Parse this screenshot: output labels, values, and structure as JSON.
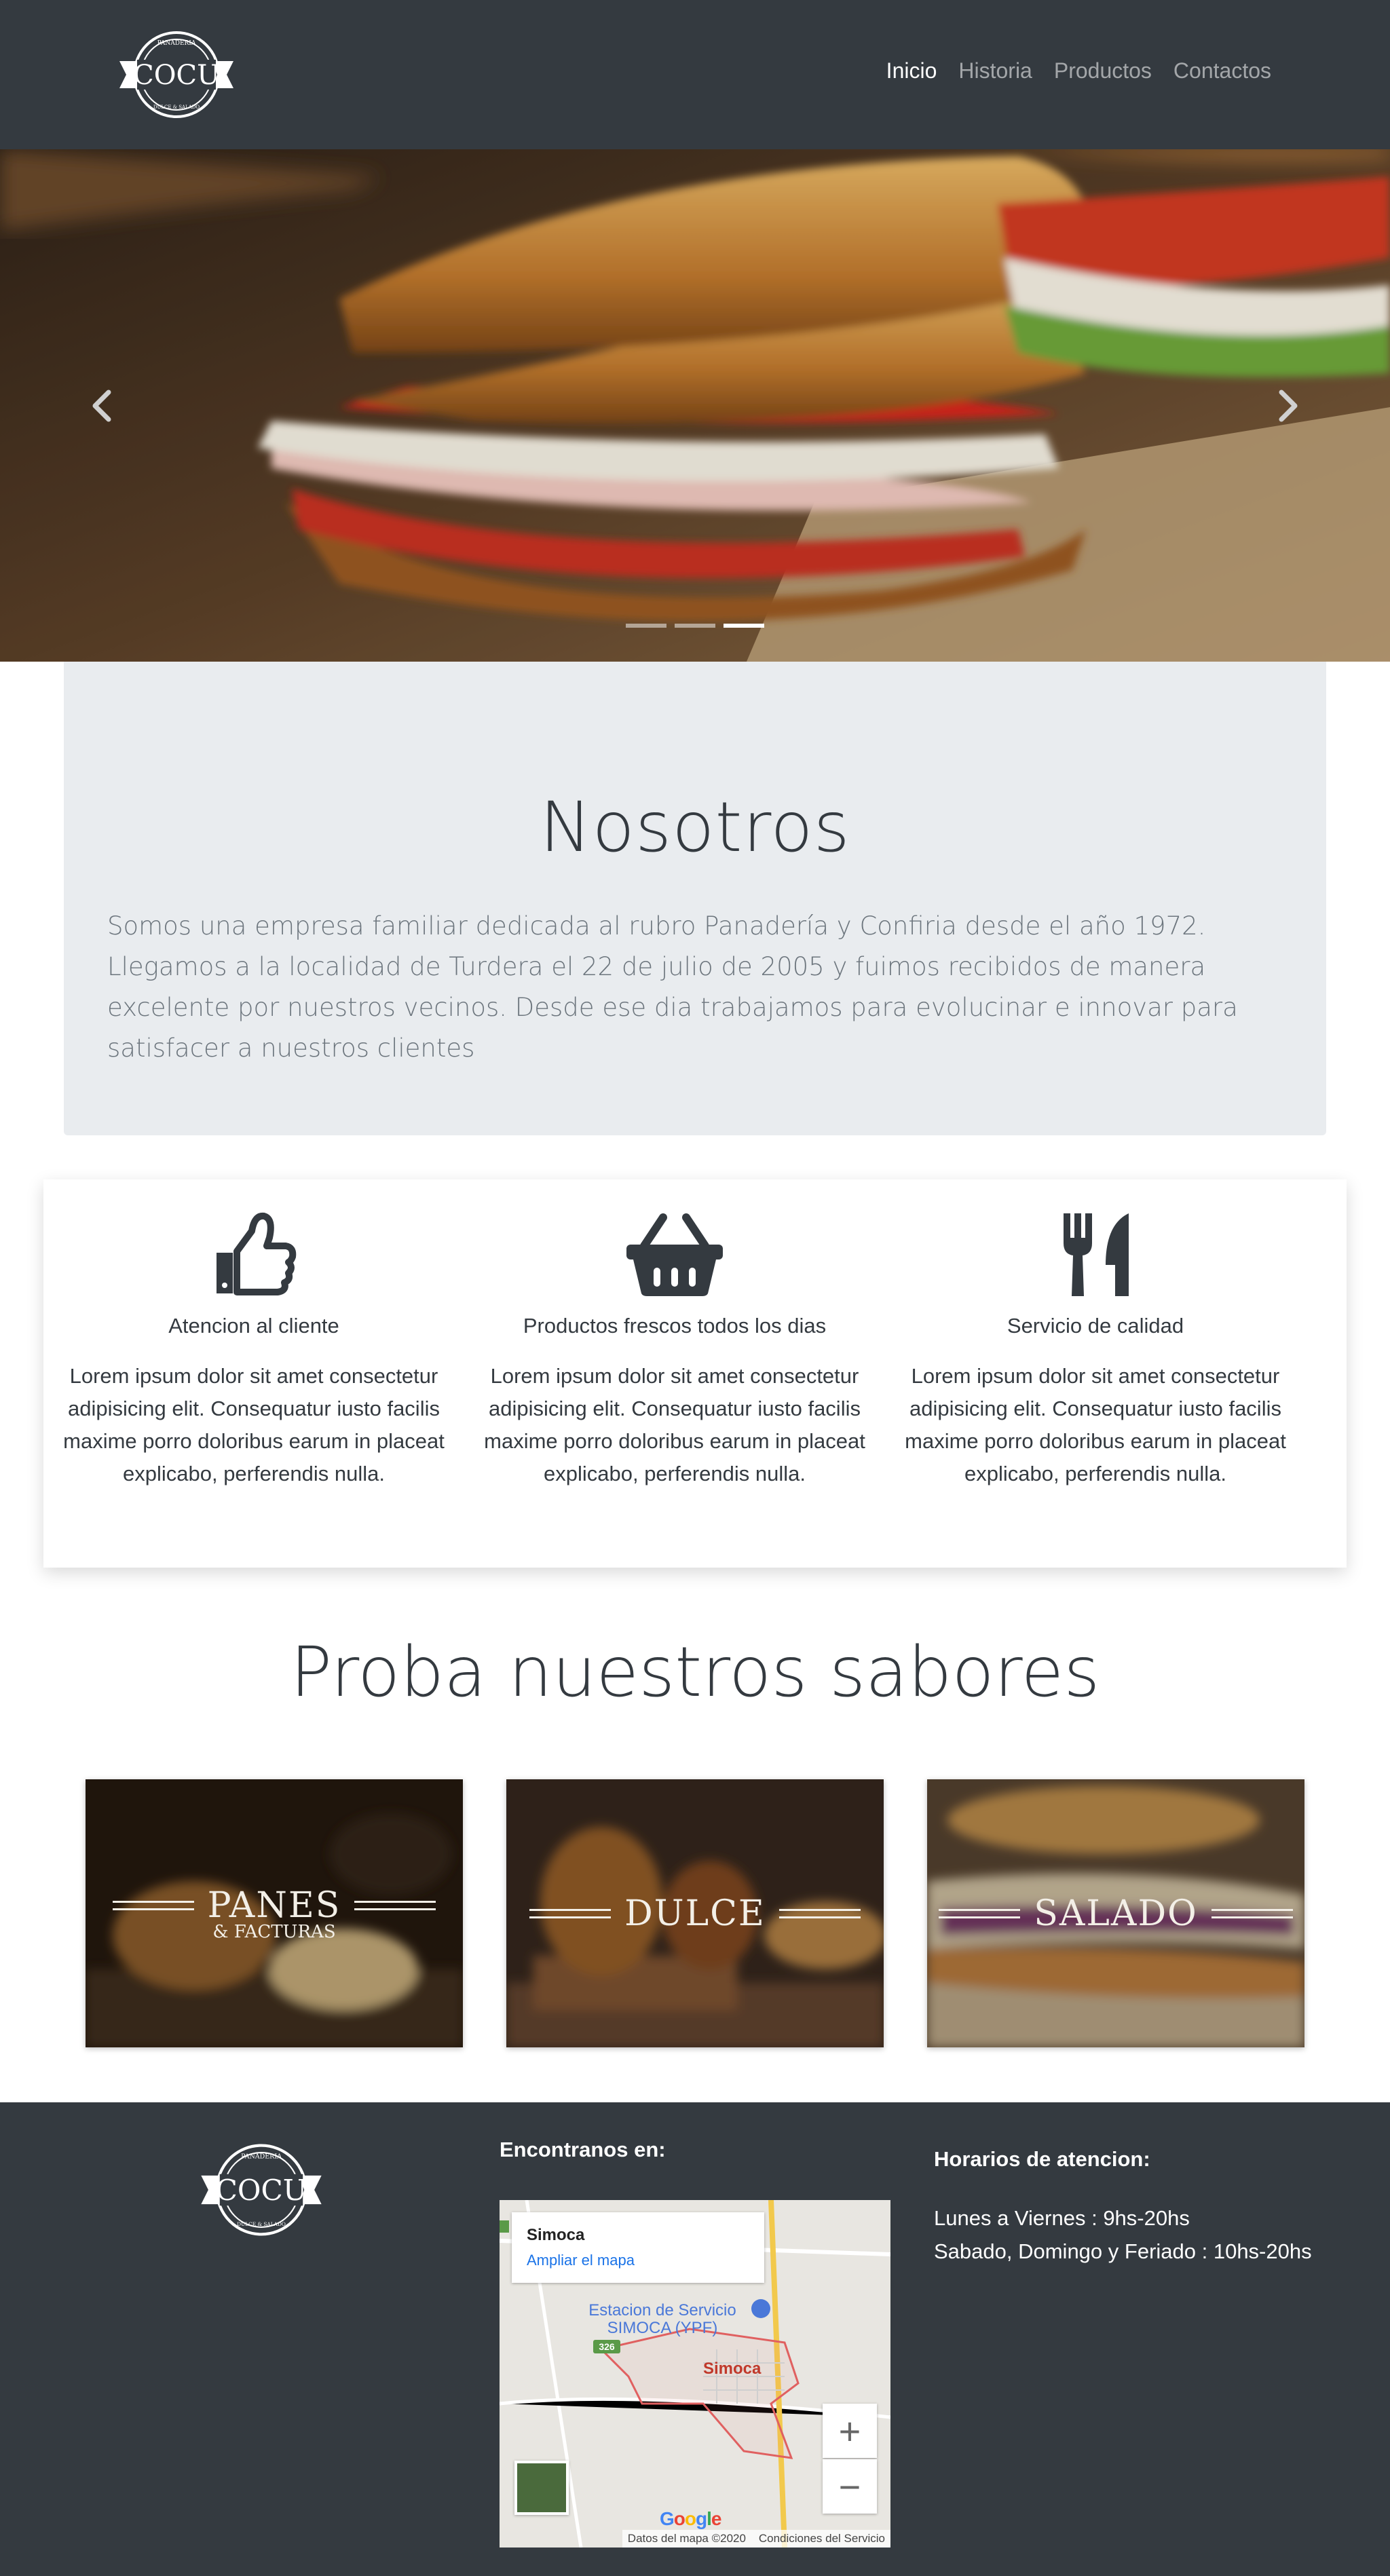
{
  "brand": {
    "name": "COCU",
    "arc_top": "PANADERIA",
    "arc_bottom": "DULCE & SALADO"
  },
  "nav": {
    "items": [
      {
        "label": "Inicio",
        "active": true
      },
      {
        "label": "Historia",
        "active": false
      },
      {
        "label": "Productos",
        "active": false
      },
      {
        "label": "Contactos",
        "active": false
      }
    ]
  },
  "carousel": {
    "prev_icon": "chevron-left-icon",
    "next_icon": "chevron-right-icon",
    "slide_count": 3,
    "active_slide": 3
  },
  "nosotros": {
    "title": "Nosotros",
    "text": "Somos una empresa familiar dedicada al rubro Panadería y Confiria desde el año 1972. Llegamos a la localidad de Turdera el 22 de julio de 2005 y fuimos recibidos de manera excelente por nuestros vecinos. Desde ese dia trabajamos para evolucinar e innovar para satisfacer a nuestros clientes"
  },
  "features": [
    {
      "icon": "thumbs-up-icon",
      "title": "Atencion al cliente",
      "text": "Lorem ipsum dolor sit amet consectetur adipisicing elit. Consequatur iusto facilis maxime porro doloribus earum in placeat explicabo, perferendis nulla."
    },
    {
      "icon": "shopping-basket-icon",
      "title": "Productos frescos todos los dias",
      "text": "Lorem ipsum dolor sit amet consectetur adipisicing elit. Consequatur iusto facilis maxime porro doloribus earum in placeat explicabo, perferendis nulla."
    },
    {
      "icon": "utensils-icon",
      "title": "Servicio de calidad",
      "text": "Lorem ipsum dolor sit amet consectetur adipisicing elit. Consequatur iusto facilis maxime porro doloribus earum in placeat explicabo, perferendis nulla."
    }
  ],
  "sabores": {
    "title": "Proba nuestros sabores",
    "cards": [
      {
        "label": "PANES",
        "sublabel": "& FACTURAS"
      },
      {
        "label": "DULCE",
        "sublabel": ""
      },
      {
        "label": "SALADO",
        "sublabel": ""
      }
    ]
  },
  "footer": {
    "find_us": "Encontranos en:",
    "map": {
      "place_name": "Simoca",
      "enlarge_link": "Ampliar el mapa",
      "poi_label_line1": "Estacion de Servicio",
      "poi_label_line2": "SIMOCA (YPF)",
      "town_label": "Simoca",
      "route_label": "326",
      "zoom_in": "+",
      "zoom_out": "−",
      "attribution_data": "Datos del mapa ©2020",
      "attribution_terms": "Condiciones del Servicio",
      "google": "Google"
    },
    "hours_title": "Horarios de atencion:",
    "hours_weekdays": "Lunes a Viernes : 9hs-20hs",
    "hours_weekend": "Sabado, Domingo y Feriado : 10hs-20hs"
  },
  "colors": {
    "dark": "#343a40",
    "jumbotron": "#e9ecef",
    "muted": "#6c757d",
    "link_blue": "#1a73e8"
  }
}
